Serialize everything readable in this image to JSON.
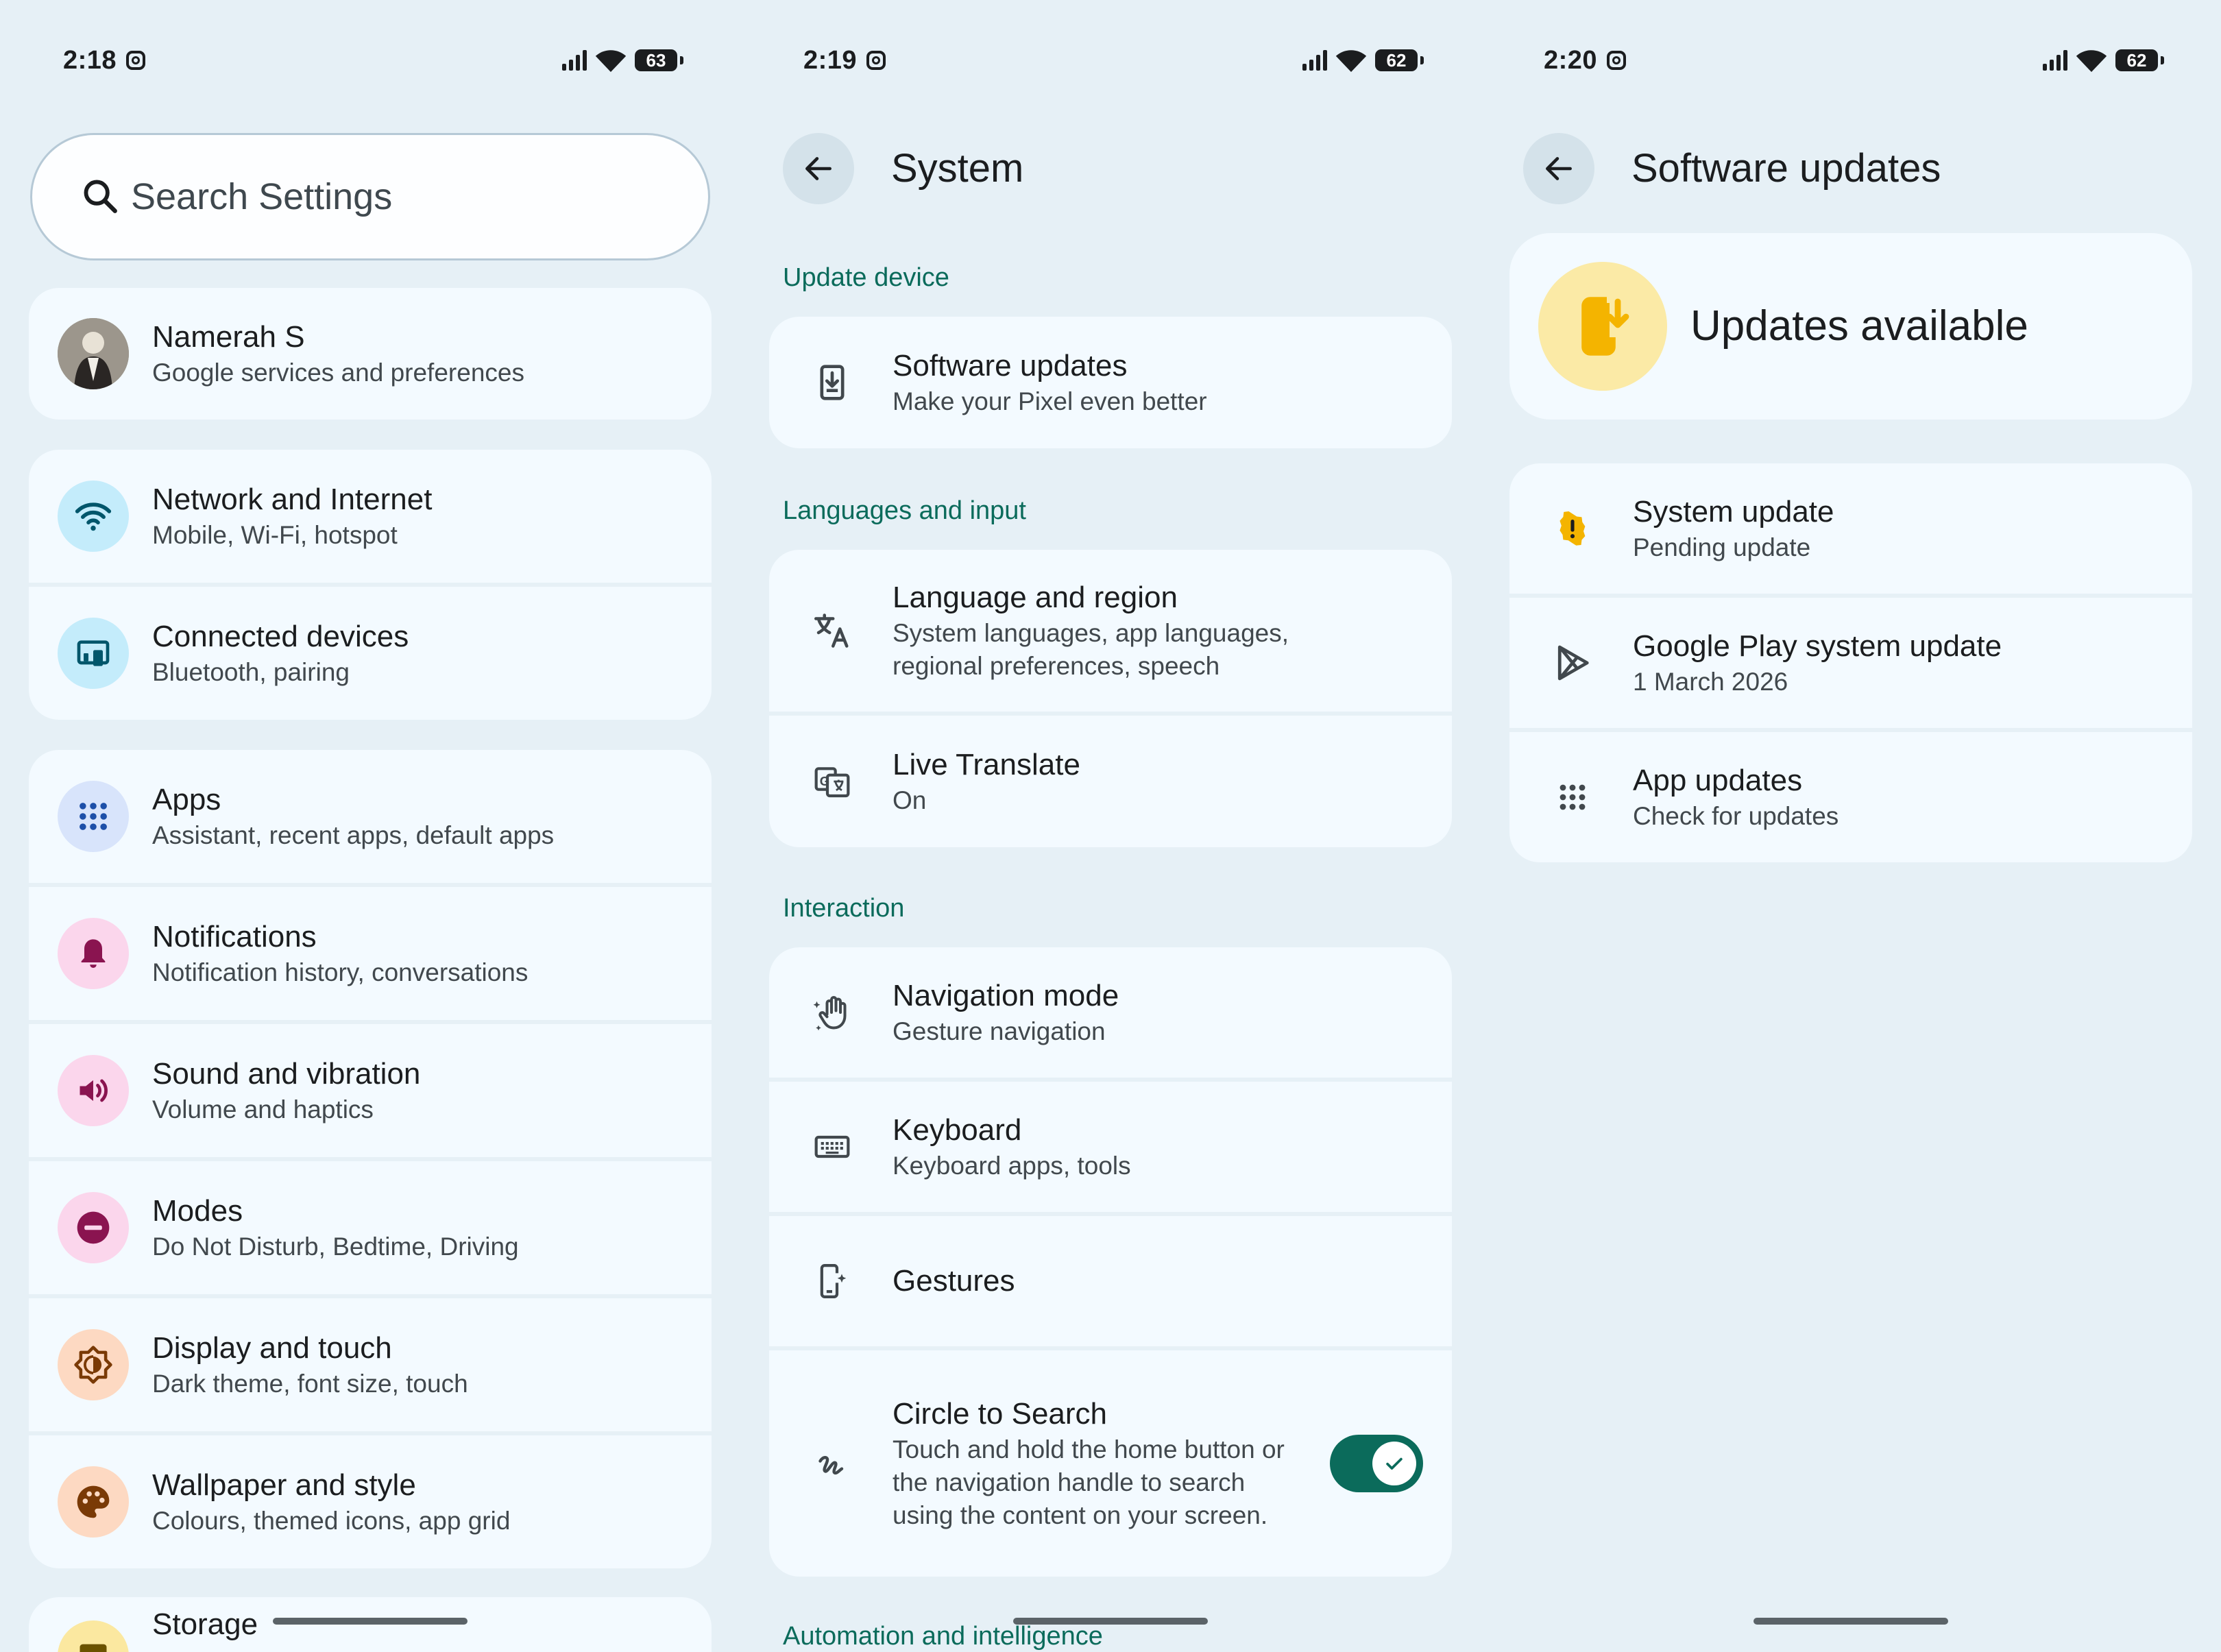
{
  "colors": {
    "background": "#e6f0f6",
    "card": "#f3faff",
    "accent_green": "#0b6b5b",
    "section_header": "#0b6b5b",
    "warning_yellow": "#f4b400"
  },
  "screen1": {
    "status": {
      "time": "2:18",
      "battery": "63"
    },
    "search": {
      "placeholder": "Search Settings",
      "icon": "search-icon"
    },
    "account": {
      "name": "Namerah S",
      "subtitle": "Google services and preferences",
      "icon": "avatar"
    },
    "items": [
      {
        "title": "Network and Internet",
        "subtitle": "Mobile, Wi-Fi, hotspot",
        "icon": "wifi-icon",
        "color": "#c4ecfb"
      },
      {
        "title": "Connected devices",
        "subtitle": "Bluetooth, pairing",
        "icon": "devices-icon",
        "color": "#c4ecfb"
      },
      {
        "title": "Apps",
        "subtitle": "Assistant, recent apps, default apps",
        "icon": "apps-grid-icon",
        "color": "#d8e4fb"
      },
      {
        "title": "Notifications",
        "subtitle": "Notification history, conversations",
        "icon": "bell-icon",
        "color": "#fbd6ec"
      },
      {
        "title": "Sound and vibration",
        "subtitle": "Volume and haptics",
        "icon": "speaker-icon",
        "color": "#fbd6ec"
      },
      {
        "title": "Modes",
        "subtitle": "Do Not Disturb, Bedtime, Driving",
        "icon": "do-not-disturb-icon",
        "color": "#fbd6ec"
      },
      {
        "title": "Display and touch",
        "subtitle": "Dark theme, font size, touch",
        "icon": "brightness-icon",
        "color": "#fdd9c2"
      },
      {
        "title": "Wallpaper and style",
        "subtitle": "Colours, themed icons, app grid",
        "icon": "palette-icon",
        "color": "#fdd9c2"
      },
      {
        "title": "Storage",
        "subtitle": "",
        "icon": "storage-icon",
        "color": "#fbe8a0"
      }
    ]
  },
  "screen2": {
    "status": {
      "time": "2:19",
      "battery": "62"
    },
    "title": "System",
    "sections": [
      {
        "header": "Update device"
      },
      {
        "header": "Languages and input"
      },
      {
        "header": "Interaction"
      },
      {
        "header": "Automation and intelligence"
      }
    ],
    "items": {
      "software_updates": {
        "title": "Software updates",
        "subtitle": "Make your Pixel even better",
        "icon": "phone-download-icon"
      },
      "language_region": {
        "title": "Language and region",
        "subtitle": "System languages, app languages, regional preferences, speech",
        "icon": "translate-icon"
      },
      "live_translate": {
        "title": "Live Translate",
        "subtitle": "On",
        "icon": "google-translate-icon"
      },
      "navigation_mode": {
        "title": "Navigation mode",
        "subtitle": "Gesture navigation",
        "icon": "gesture-hand-icon"
      },
      "keyboard": {
        "title": "Keyboard",
        "subtitle": "Keyboard apps, tools",
        "icon": "keyboard-icon"
      },
      "gestures": {
        "title": "Gestures",
        "subtitle": "",
        "icon": "phone-sparkle-icon"
      },
      "circle_to_search": {
        "title": "Circle to Search",
        "subtitle": "Touch and hold the home button or the navigation handle to search using the content on your screen.",
        "icon": "squiggle-icon",
        "toggle_on": true
      }
    }
  },
  "screen3": {
    "status": {
      "time": "2:20",
      "battery": "62"
    },
    "title": "Software updates",
    "hero": {
      "text": "Updates available",
      "icon": "phone-download-icon"
    },
    "items": [
      {
        "title": "System update",
        "subtitle": "Pending update",
        "icon": "warning-icon"
      },
      {
        "title": "Google Play system update",
        "subtitle": "1 March 2026",
        "icon": "play-store-icon"
      },
      {
        "title": "App updates",
        "subtitle": "Check for updates",
        "icon": "apps-grid-icon"
      }
    ]
  }
}
